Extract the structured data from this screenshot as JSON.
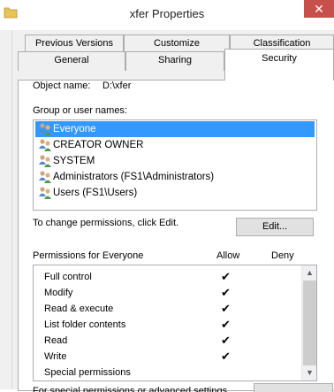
{
  "window": {
    "title": "xfer Properties",
    "close_glyph": "✕"
  },
  "tabs_row1": [
    {
      "label": "Previous Versions"
    },
    {
      "label": "Customize"
    },
    {
      "label": "Classification"
    }
  ],
  "tabs_row2": [
    {
      "label": "General"
    },
    {
      "label": "Sharing"
    },
    {
      "label": "Security",
      "active": true
    }
  ],
  "security": {
    "object_name_label": "Object name:",
    "object_name_value": "D:\\xfer",
    "group_label": "Group or user names:",
    "users": [
      {
        "name": "Everyone",
        "selected": true
      },
      {
        "name": "CREATOR OWNER"
      },
      {
        "name": "SYSTEM"
      },
      {
        "name": "Administrators (FS1\\Administrators)"
      },
      {
        "name": "Users (FS1\\Users)"
      }
    ],
    "change_hint": "To change permissions, click Edit.",
    "edit_button": "Edit...",
    "permissions_for": "Permissions for Everyone",
    "allow_header": "Allow",
    "deny_header": "Deny",
    "permissions": [
      {
        "name": "Full control",
        "allow": true
      },
      {
        "name": "Modify",
        "allow": true
      },
      {
        "name": "Read & execute",
        "allow": true
      },
      {
        "name": "List folder contents",
        "allow": true
      },
      {
        "name": "Read",
        "allow": true
      },
      {
        "name": "Write",
        "allow": true
      },
      {
        "name": "Special permissions",
        "allow": false
      }
    ],
    "check_glyph": "✔",
    "partial_text": "For special permissions or advanced settings,"
  },
  "colors": {
    "selection": "#3399ff",
    "close": "#c7504b"
  }
}
